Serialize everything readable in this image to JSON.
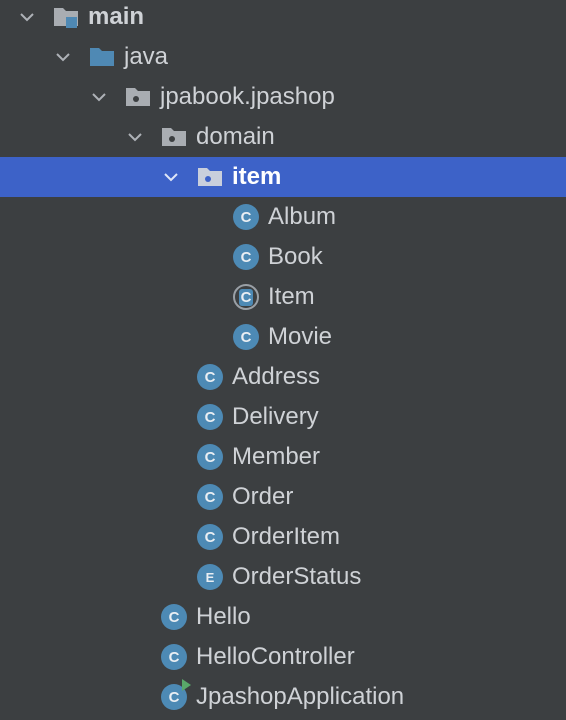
{
  "tree": {
    "nodes": [
      {
        "label": "main",
        "kind": "source-root",
        "expanded": true
      },
      {
        "label": "java",
        "kind": "source-folder",
        "expanded": true
      },
      {
        "label": "jpabook.jpashop",
        "kind": "package",
        "expanded": true
      },
      {
        "label": "domain",
        "kind": "package",
        "expanded": true
      },
      {
        "label": "item",
        "kind": "package",
        "expanded": true,
        "selected": true
      },
      {
        "label": "Album",
        "kind": "class",
        "letter": "C"
      },
      {
        "label": "Book",
        "kind": "class",
        "letter": "C"
      },
      {
        "label": "Item",
        "kind": "abstract-class",
        "letter": "C"
      },
      {
        "label": "Movie",
        "kind": "class",
        "letter": "C"
      },
      {
        "label": "Address",
        "kind": "class",
        "letter": "C"
      },
      {
        "label": "Delivery",
        "kind": "class",
        "letter": "C"
      },
      {
        "label": "Member",
        "kind": "class",
        "letter": "C"
      },
      {
        "label": "Order",
        "kind": "class",
        "letter": "C"
      },
      {
        "label": "OrderItem",
        "kind": "class",
        "letter": "C"
      },
      {
        "label": "OrderStatus",
        "kind": "enum",
        "letter": "E"
      },
      {
        "label": "Hello",
        "kind": "class",
        "letter": "C"
      },
      {
        "label": "HelloController",
        "kind": "class",
        "letter": "C"
      },
      {
        "label": "JpashopApplication",
        "kind": "runnable-class",
        "letter": "C"
      }
    ]
  },
  "colors": {
    "background": "#3c3f41",
    "selection": "#3d62c8",
    "class_icon": "#4d8ab5",
    "folder_icon": "#4f89b4",
    "package_icon": "#a9adb2",
    "run_badge": "#59a869"
  }
}
